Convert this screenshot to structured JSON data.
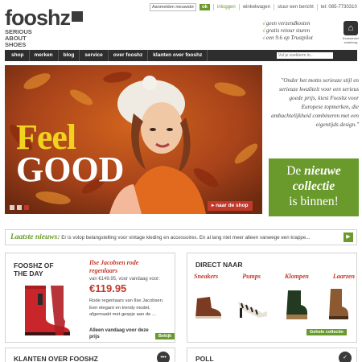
{
  "brand": {
    "name": "fooshz",
    "tagline_1": "SERIOUS",
    "tagline_2": "ABOUT",
    "tagline_3": "SHOES"
  },
  "topbar": {
    "newsletter_value": "Aanmelden nieuwsbrief",
    "ok_label": "ok",
    "login": "inloggen",
    "cart": "winkelwagen",
    "contact": "stuur een bericht",
    "phone": "tel: 085-7730310"
  },
  "usps": [
    "geen verzendkosten",
    "gratis retour sturen",
    "een 9.6 op Trustpilot"
  ],
  "trustmark": {
    "label_1": "thuiswinkel",
    "label_2": "waarborg"
  },
  "nav": {
    "items": [
      "shop",
      "merken",
      "blog",
      "service",
      "over fooshz",
      "klanten over fooshz"
    ],
    "search_placeholder": "Vul je zoekterm in..."
  },
  "hero": {
    "word_1": "Feel",
    "word_2": "GOOD",
    "cta": "naar de shop",
    "slides": 3,
    "active_slide": 3
  },
  "quote": "\"Onder het motto serieuze stijl en serieuze kwaliteit voor een serieus goede prijs, kiest Fooshz voor Europese topmerken, die ambachtelijkheid combineren met een eigentijds design.\"",
  "collection": {
    "line_1_a": "De ",
    "line_1_b": "nieuwe",
    "line_2": "collectie",
    "line_3": "is binnen!"
  },
  "news": {
    "label": "Laatste nieuws:",
    "text": "Er is volop belangstelling voor vintage kleding en accessoires. En al lang niet meer alleen vanwege een krappe..."
  },
  "fotd": {
    "title_1": "FOOSHZ OF",
    "title_2": "THE DAY",
    "product_1": "Ilse Jacobsen rode",
    "product_2": "regenlaars",
    "was": "van €149.95, voor vandaag voor:",
    "price": "€119.95",
    "desc": "Rode regenlaars van Ilse Jacobsen. Een elegant en trendy model, afgemaakt met gespje aan de ...",
    "only": "Alleen vandaag voor deze prijs",
    "buy": "Bekijk"
  },
  "direct": {
    "title": "DIRECT NAAR",
    "categories": [
      "Sneakers",
      "Pumps",
      "Klompen",
      "Laarzen"
    ],
    "all_button": "Gehele collectie"
  },
  "bottom": {
    "klanten": "KLANTEN OVER FOOSHZ",
    "poll": "POLL"
  },
  "colors": {
    "green": "#6a9a2c",
    "red": "#c0392b",
    "dark": "#2e2e2e",
    "yellow": "#f1d21f"
  }
}
